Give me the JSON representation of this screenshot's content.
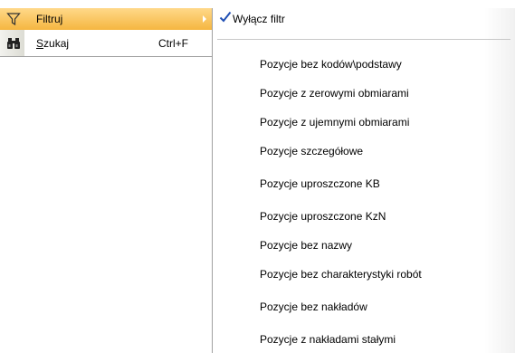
{
  "menu": {
    "items": [
      {
        "label": "Filtruj",
        "icon": "funnel-icon",
        "has_submenu": true,
        "highlighted": true
      },
      {
        "label_mnemonic": "S",
        "label_rest": "zukaj",
        "shortcut": "Ctrl+F",
        "icon": "binoculars-icon"
      }
    ]
  },
  "submenu": {
    "items": [
      {
        "label": "Wyłącz filtr",
        "checked": true
      },
      {
        "label": "Pozycje bez kodów\\podstawy"
      },
      {
        "label": "Pozycje z zerowymi obmiarami"
      },
      {
        "label": "Pozycje z ujemnymi obmiarami"
      },
      {
        "label": "Pozycje szczegółowe"
      },
      {
        "label": "Pozycje uproszczone KB"
      },
      {
        "label": "Pozycje uproszczone KzN"
      },
      {
        "label": "Pozycje bez nazwy"
      },
      {
        "label": "Pozycje bez charakterystyki robót"
      },
      {
        "label": "Pozycje bez nakładów"
      },
      {
        "label": "Pozycje z nakładami stałymi"
      }
    ]
  },
  "colors": {
    "highlight": "#f5b640",
    "check": "#1f4fb4"
  }
}
